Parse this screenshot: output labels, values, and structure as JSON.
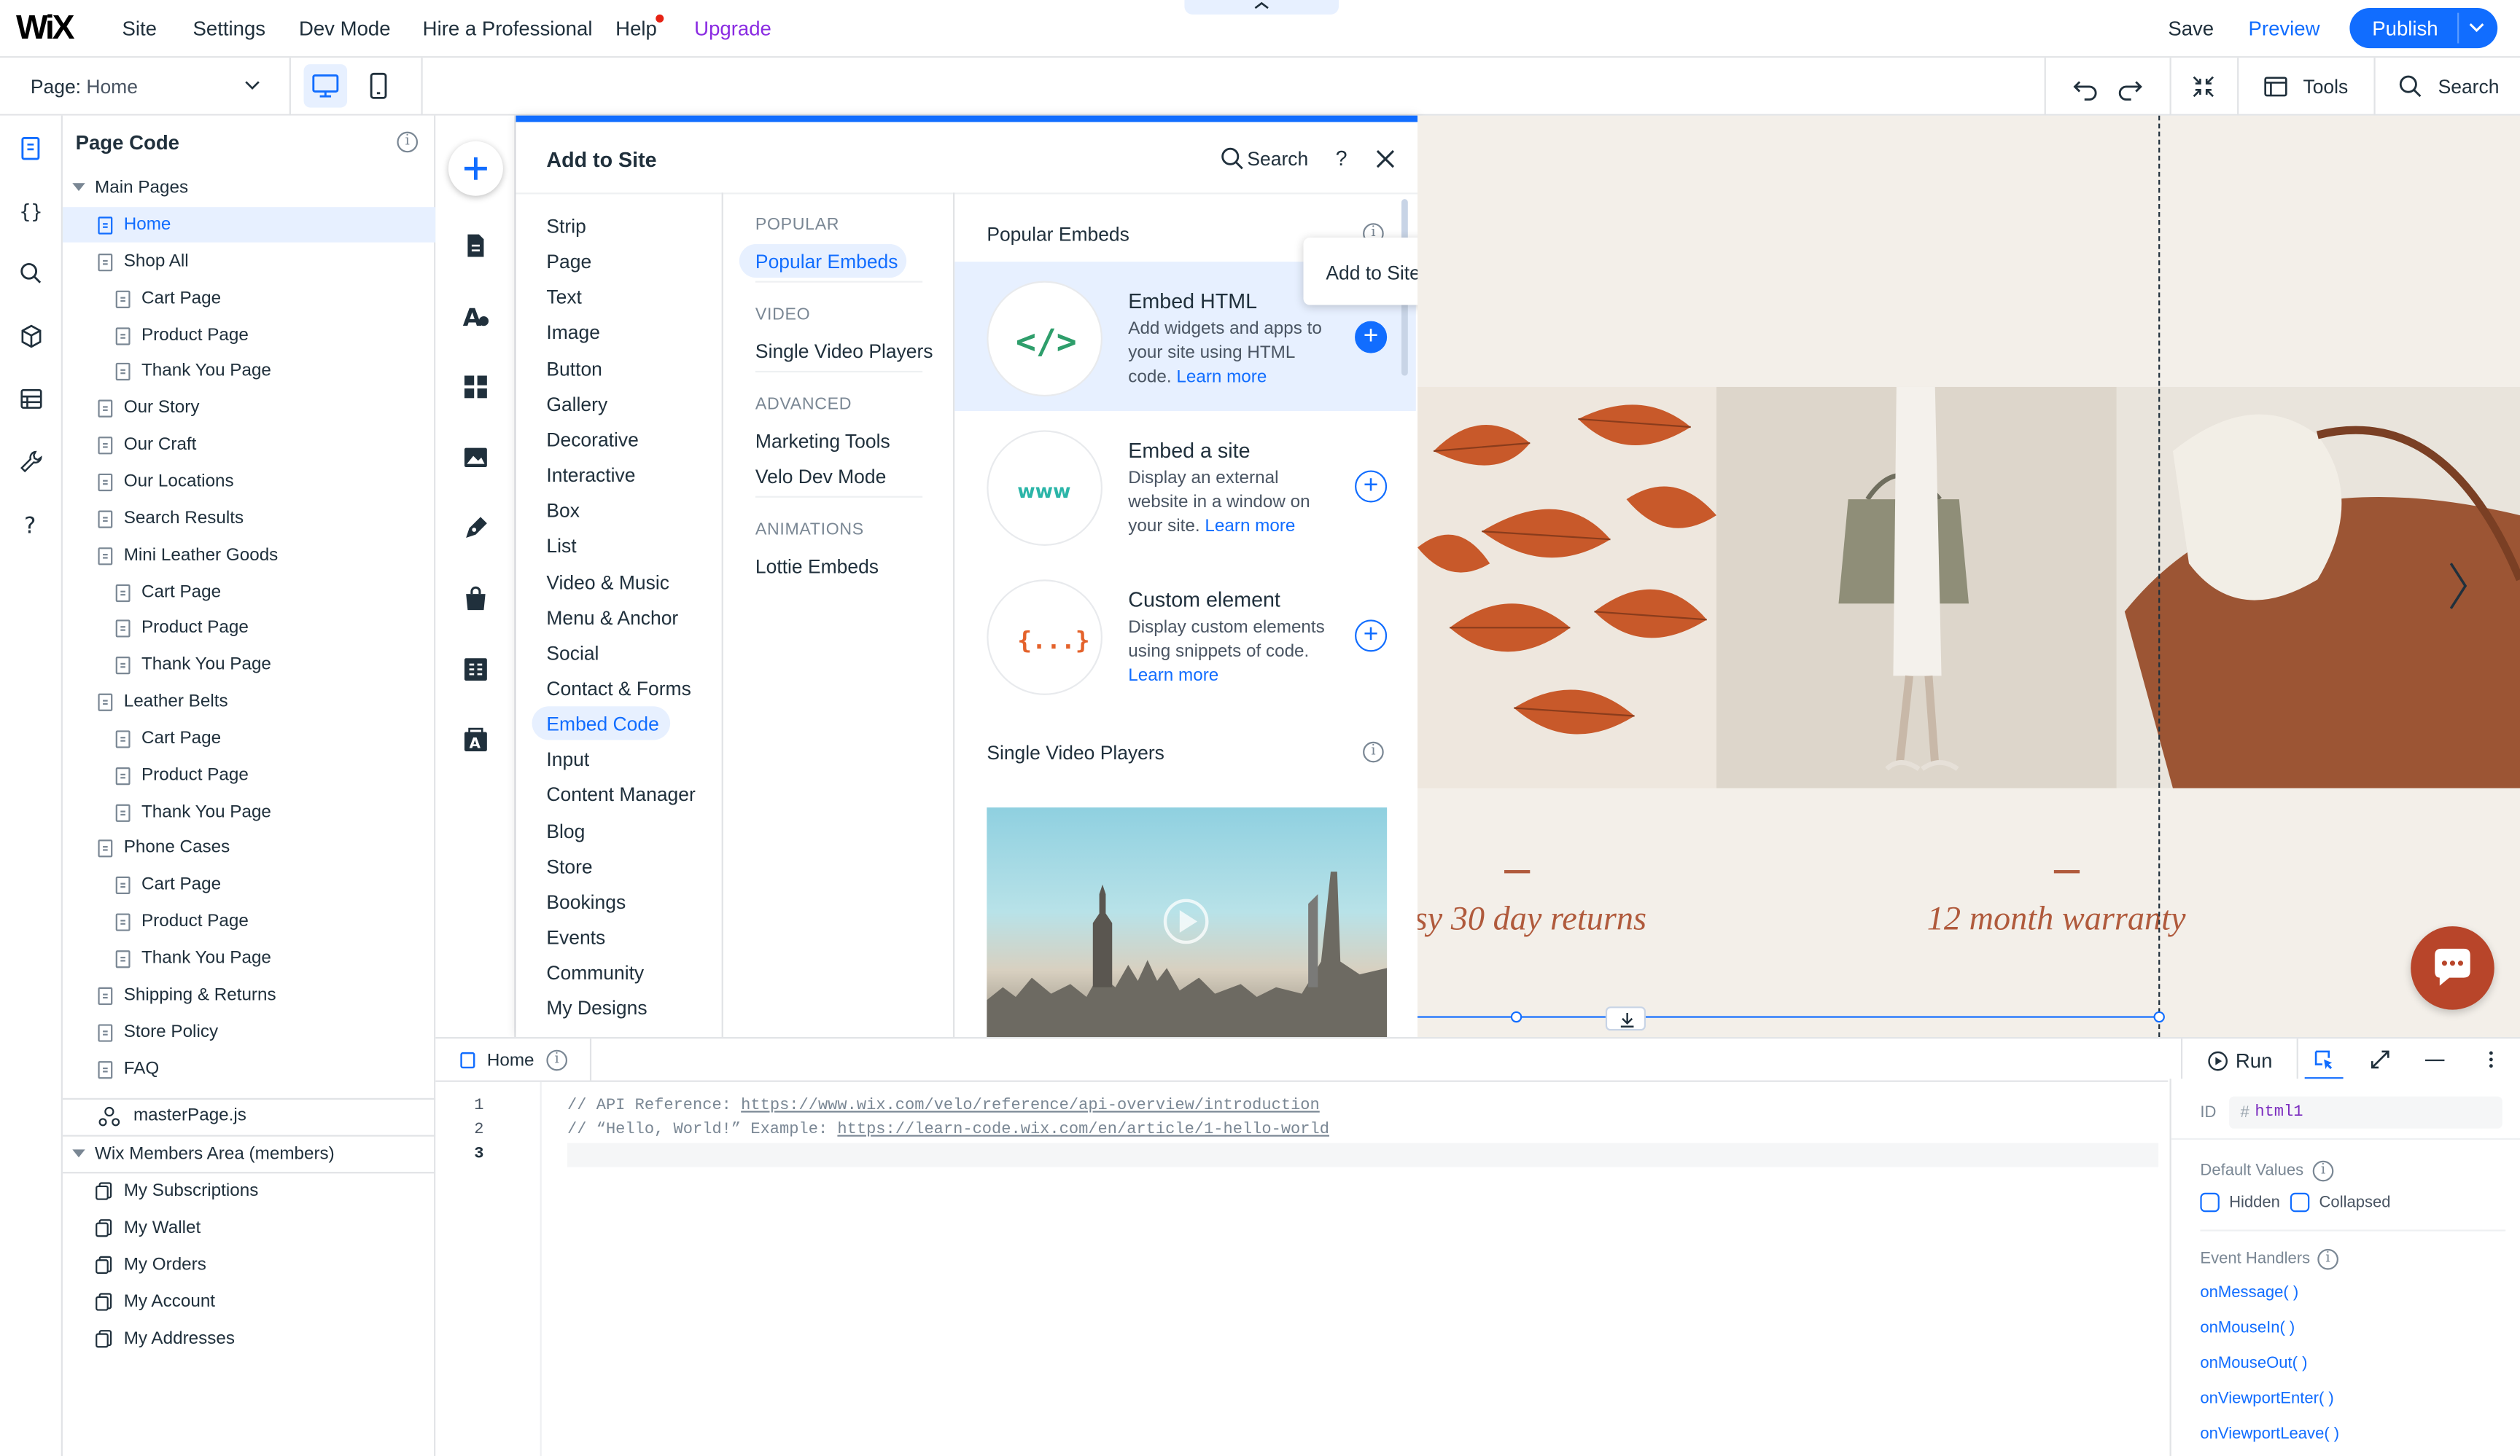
{
  "topbar": {
    "logo": "WiX",
    "menu": [
      "Site",
      "Settings",
      "Dev Mode",
      "Hire a Professional",
      "Help",
      "Upgrade"
    ],
    "save": "Save",
    "preview": "Preview",
    "publish": "Publish"
  },
  "subbar": {
    "page_label": "Page:",
    "page_name": "Home",
    "tools": "Tools",
    "search": "Search"
  },
  "sidebar": {
    "title": "Page Code",
    "main_pages": "Main Pages",
    "pages": [
      {
        "label": "Home",
        "level": 1,
        "selected": true
      },
      {
        "label": "Shop All",
        "level": 1
      },
      {
        "label": "Cart Page",
        "level": 2
      },
      {
        "label": "Product Page",
        "level": 2
      },
      {
        "label": "Thank You Page",
        "level": 2
      },
      {
        "label": "Our Story",
        "level": 1
      },
      {
        "label": "Our Craft",
        "level": 1
      },
      {
        "label": "Our Locations",
        "level": 1
      },
      {
        "label": "Search Results",
        "level": 1
      },
      {
        "label": "Mini Leather Goods",
        "level": 1
      },
      {
        "label": "Cart Page",
        "level": 2
      },
      {
        "label": "Product Page",
        "level": 2
      },
      {
        "label": "Thank You Page",
        "level": 2
      },
      {
        "label": "Leather Belts",
        "level": 1
      },
      {
        "label": "Cart Page",
        "level": 2
      },
      {
        "label": "Product Page",
        "level": 2
      },
      {
        "label": "Thank You Page",
        "level": 2
      },
      {
        "label": "Phone Cases",
        "level": 1
      },
      {
        "label": "Cart Page",
        "level": 2
      },
      {
        "label": "Product Page",
        "level": 2
      },
      {
        "label": "Thank You Page",
        "level": 2
      },
      {
        "label": "Shipping & Returns",
        "level": 1
      },
      {
        "label": "Store Policy",
        "level": 1
      },
      {
        "label": "FAQ",
        "level": 1
      }
    ],
    "master_page": "masterPage.js",
    "members_area": "Wix Members Area (members)",
    "members_pages": [
      "My Subscriptions",
      "My Wallet",
      "My Orders",
      "My Account",
      "My Addresses"
    ]
  },
  "add_panel": {
    "title": "Add to Site",
    "search": "Search",
    "help": "?",
    "categories": [
      "Strip",
      "Page",
      "Text",
      "Image",
      "Button",
      "Gallery",
      "Decorative",
      "Interactive",
      "Box",
      "List",
      "Video & Music",
      "Menu & Anchor",
      "Social",
      "Contact & Forms",
      "Embed Code",
      "Input",
      "Content Manager",
      "Blog",
      "Store",
      "Bookings",
      "Events",
      "Community",
      "My Designs"
    ],
    "selected_category": "Embed Code",
    "sections": [
      {
        "title": "POPULAR",
        "items": [
          "Popular Embeds"
        ]
      },
      {
        "title": "VIDEO",
        "items": [
          "Single Video Players"
        ]
      },
      {
        "title": "ADVANCED",
        "items": [
          "Marketing Tools",
          "Velo Dev Mode"
        ]
      },
      {
        "title": "ANIMATIONS",
        "items": [
          "Lottie Embeds"
        ]
      }
    ],
    "popular_embeds_title": "Popular Embeds",
    "tooltip": "Add to Site",
    "cards": [
      {
        "title": "Embed HTML",
        "desc": "Add widgets and apps to your site using HTML code.",
        "link": "Learn more",
        "glyph": "</>"
      },
      {
        "title": "Embed a site",
        "desc": "Display an external website in a window on your site.",
        "link": "Learn more",
        "glyph": "www"
      },
      {
        "title": "Custom element",
        "desc": "Display custom elements using snippets of code.",
        "link": "Learn more",
        "glyph": "{...}"
      }
    ],
    "video_section_title": "Single Video Players"
  },
  "canvas": {
    "text_left": "sy 30 day returns",
    "text_right": "12 month warranty"
  },
  "code_panel": {
    "tab": "Home",
    "run": "Run",
    "line_numbers": [
      "1",
      "2",
      "3"
    ],
    "lines": [
      {
        "prefix": "// API Reference: ",
        "url": "https://www.wix.com/velo/reference/api-overview/introduction"
      },
      {
        "prefix": "// “Hello, World!” Example: ",
        "url": "https://learn-code.wix.com/en/article/1-hello-world"
      }
    ]
  },
  "properties": {
    "id_label": "ID",
    "id_hash": "#",
    "id_value": "html1",
    "default_values": "Default Values",
    "hidden": "Hidden",
    "collapsed": "Collapsed",
    "event_handlers": "Event Handlers",
    "events": [
      "onMessage( )",
      "onMouseIn( )",
      "onMouseOut( )",
      "onViewportEnter( )",
      "onViewportLeave( )"
    ]
  },
  "colors": {
    "accent": "#116dff",
    "upgrade": "#8a2be2",
    "warm_text": "#b05a3c",
    "chat": "#b8452a"
  }
}
